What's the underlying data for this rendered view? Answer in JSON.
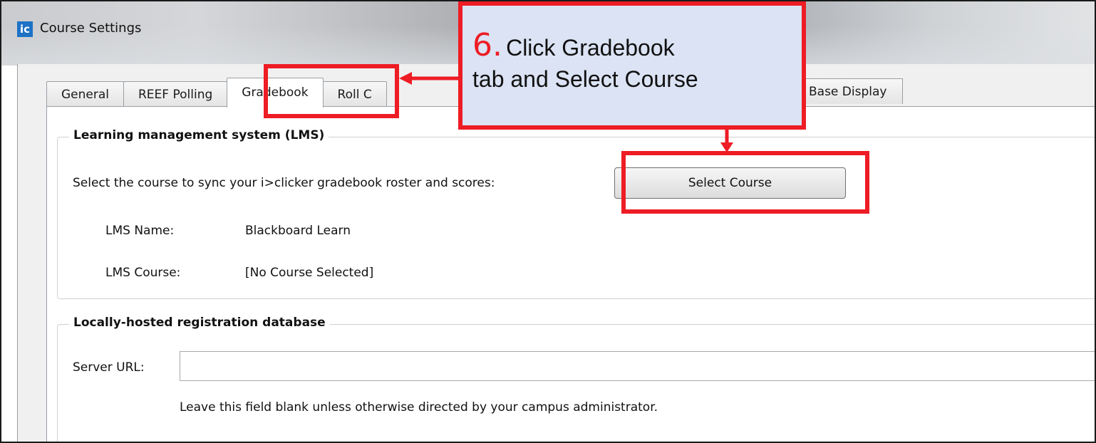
{
  "window": {
    "title": "Course Settings",
    "icon_label": "ic"
  },
  "tabs": [
    {
      "label": "General",
      "active": false
    },
    {
      "label": "REEF Polling",
      "active": false
    },
    {
      "label": "Gradebook",
      "active": true
    },
    {
      "label": "Roll C",
      "active": false
    },
    {
      "label": "Base Display",
      "active": false
    }
  ],
  "lms": {
    "legend": "Learning management system (LMS)",
    "prompt": "Select the course to sync your i>clicker gradebook roster and scores:",
    "select_button": "Select Course",
    "name_label": "LMS Name:",
    "name_value": "Blackboard Learn",
    "course_label": "LMS Course:",
    "course_value": "[No Course Selected]"
  },
  "registration": {
    "legend": "Locally-hosted registration database",
    "server_url_label": "Server URL:",
    "server_url_value": "",
    "hint": "Leave this field blank unless otherwise directed by your campus administrator."
  },
  "callout": {
    "step": "6.",
    "line1": "Click Gradebook",
    "line2": "tab and Select Course",
    "highlight_color": "#ee1c24",
    "fill_color": "#dbe3f4"
  }
}
